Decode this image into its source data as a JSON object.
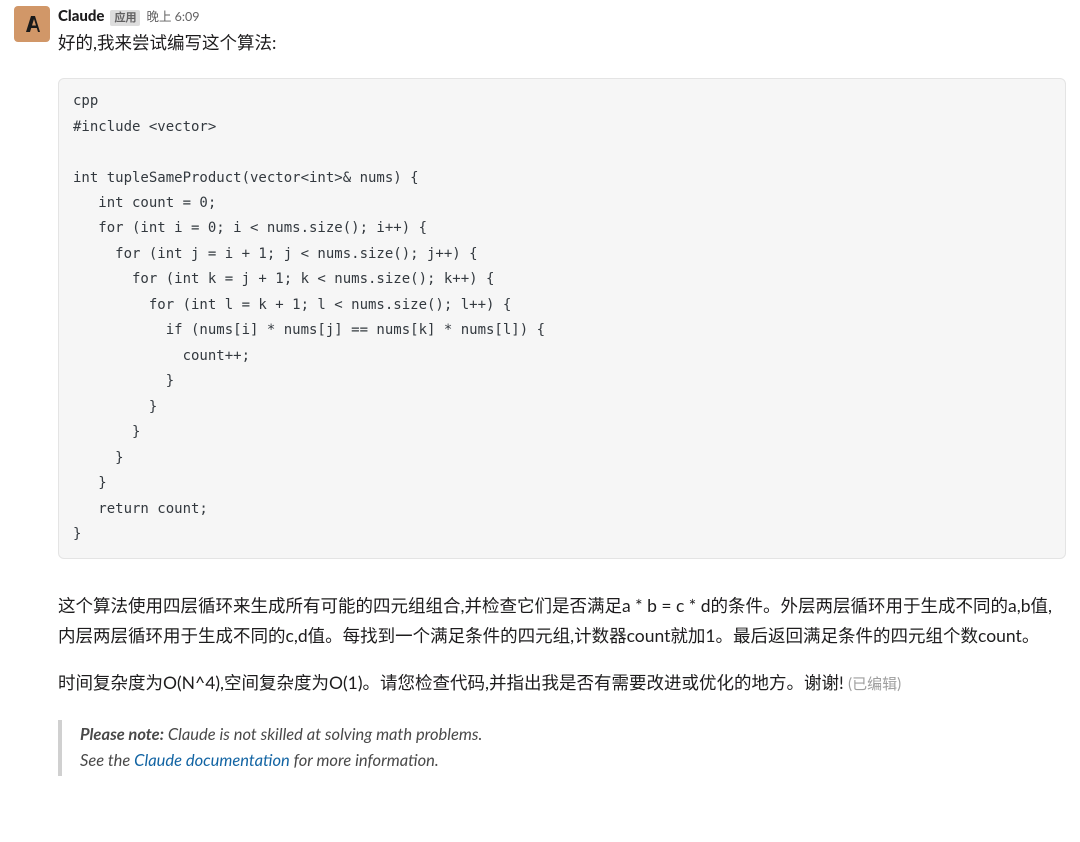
{
  "message": {
    "sender": "Claude",
    "badge": "应用",
    "timestamp": "晚上 6:09",
    "intro": "好的,我来尝试编写这个算法:",
    "code": "cpp\n#include <vector>\n\nint tupleSameProduct(vector<int>& nums) {\n   int count = 0;\n   for (int i = 0; i < nums.size(); i++) {\n     for (int j = i + 1; j < nums.size(); j++) {\n       for (int k = j + 1; k < nums.size(); k++) {\n         for (int l = k + 1; l < nums.size(); l++) {\n           if (nums[i] * nums[j] == nums[k] * nums[l]) {\n             count++;\n           }\n         }\n       }\n     }\n   }\n   return count;\n}",
    "explain1": "这个算法使用四层循环来生成所有可能的四元组组合,并检查它们是否满足a * b = c * d的条件。外层两层循环用于生成不同的a,b值,内层两层循环用于生成不同的c,d值。每找到一个满足条件的四元组,计数器count就加1。最后返回满足条件的四元组个数count。",
    "explain2_prefix": "时间复杂度为O(N^4),空间复杂度为O(1)。请您检查代码,并指出我是否有需要改进或优化的地方。谢谢!",
    "edited_label": "(已编辑)",
    "note": {
      "label": "Please note:",
      "line1_rest": " Claude is not skilled at solving math problems.",
      "line2_prefix": "See the ",
      "link_text": "Claude documentation",
      "line2_suffix": " for more information."
    }
  }
}
